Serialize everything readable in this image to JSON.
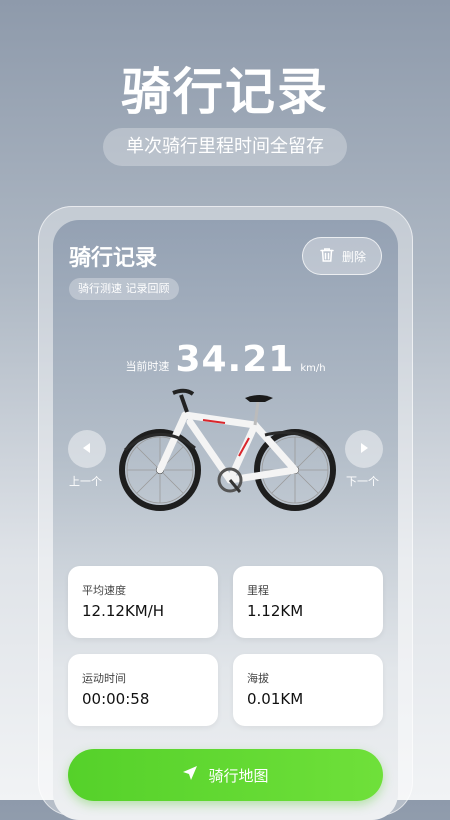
{
  "hero": {
    "title": "骑行记录",
    "subtitle": "单次骑行里程时间全留存"
  },
  "app": {
    "title": "骑行记录",
    "tag": "骑行测速 记录回顾",
    "delete_label": "删除",
    "speed": {
      "label": "当前时速",
      "value": "34.21",
      "unit": "km/h"
    },
    "nav": {
      "prev_label": "上一个",
      "next_label": "下一个"
    },
    "stats": [
      {
        "label": "平均速度",
        "value": "12.12KM/H"
      },
      {
        "label": "里程",
        "value": "1.12KM"
      },
      {
        "label": "运动时间",
        "value": "00:00:58"
      },
      {
        "label": "海拔",
        "value": "0.01KM"
      }
    ],
    "map_button_label": "骑行地图",
    "colors": {
      "accent_green": "#5ad52c",
      "bike_red": "#d9262c"
    },
    "icons": [
      "trash-icon",
      "chevron-left-icon",
      "chevron-right-icon",
      "navigation-arrow-icon",
      "bicycle-image"
    ]
  }
}
